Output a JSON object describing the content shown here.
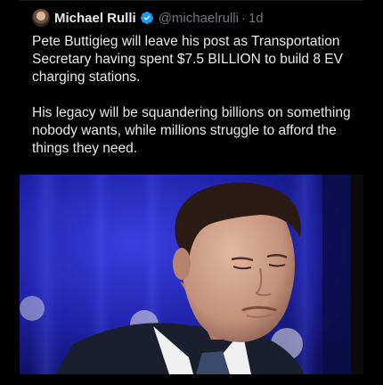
{
  "author": {
    "display_name": "Michael Rulli",
    "handle": "@michaelrulli",
    "separator": "·",
    "timestamp": "1d",
    "verified": true,
    "avatar_icon": "profile-photo-avatar",
    "verified_icon": "verified-badge-icon"
  },
  "tweet": {
    "paragraphs": [
      "Pete Buttigieg will leave his post as Transportation Secretary having spent $7.5 BILLION to build 8 EV charging stations.",
      "His legacy will be squandering billions on something nobody wants, while millions struggle to afford the things they need."
    ]
  },
  "media": {
    "kind": "photo",
    "colors": {
      "background_blue": "#1e22a8",
      "suit": "#1b1f2c",
      "shirt": "#f2f2f2",
      "skin": "#c99a82"
    }
  },
  "colors": {
    "background": "#000000",
    "text_primary": "#e7e9ea",
    "text_secondary": "#71767b",
    "verified": "#1d9bf0"
  }
}
